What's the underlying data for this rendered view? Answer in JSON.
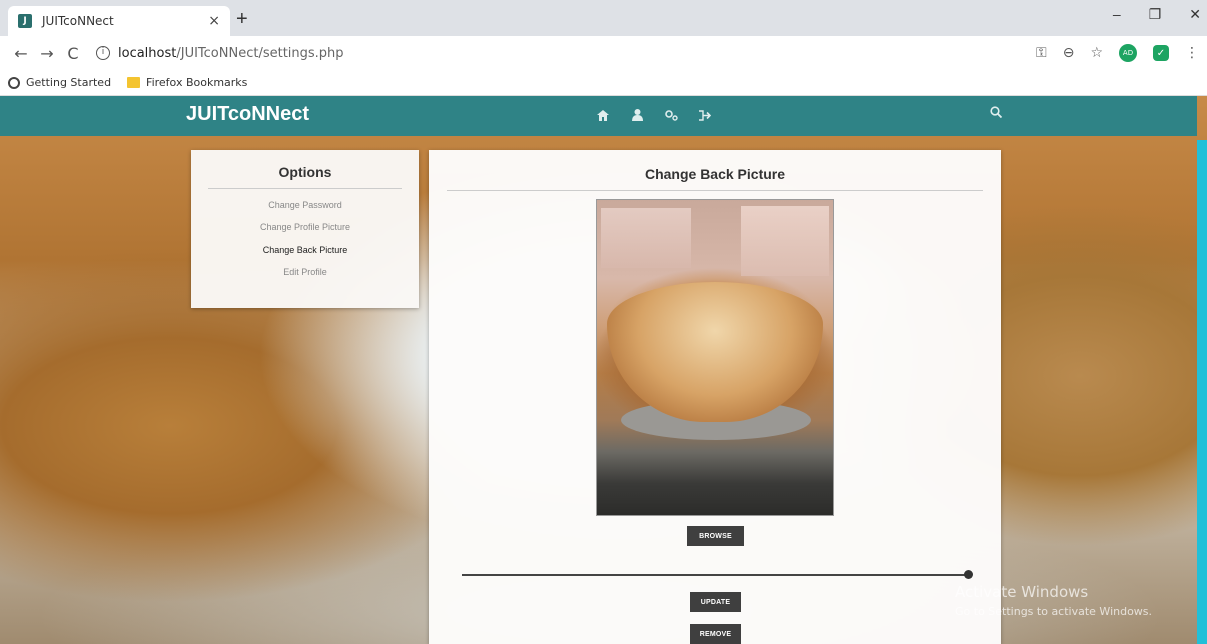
{
  "browser": {
    "tab_title": "JUITcoNNect",
    "tab_close": "×",
    "new_tab": "+",
    "url_host": "localhost",
    "url_path": "/JUITcoNNect/settings.php",
    "window_controls": [
      "–",
      "❐",
      "✕"
    ],
    "avatar_initials": "AD",
    "bookmarks": [
      "Getting Started",
      "Firefox Bookmarks"
    ]
  },
  "site": {
    "brand": "JUITcoNNect",
    "nav_icons": [
      "home-icon",
      "user-icon",
      "settings-icon",
      "logout-icon"
    ],
    "search_icon": "search-icon"
  },
  "options": {
    "title": "Options",
    "items": [
      {
        "label": "Change Password",
        "active": false
      },
      {
        "label": "Change Profile Picture",
        "active": false
      },
      {
        "label": "Change Back Picture",
        "active": true
      },
      {
        "label": "Edit Profile",
        "active": false
      }
    ]
  },
  "main": {
    "title": "Change Back Picture",
    "browse_label": "BROWSE",
    "update_label": "UPDATE",
    "remove_label": "REMOVE",
    "slider_value": 1.0
  },
  "watermark": {
    "line1": "Activate Windows",
    "line2": "Go to Settings to activate Windows."
  },
  "colors": {
    "navbar": "#2f8386",
    "button": "#3f3f3f",
    "accent": "#21c0d8"
  }
}
